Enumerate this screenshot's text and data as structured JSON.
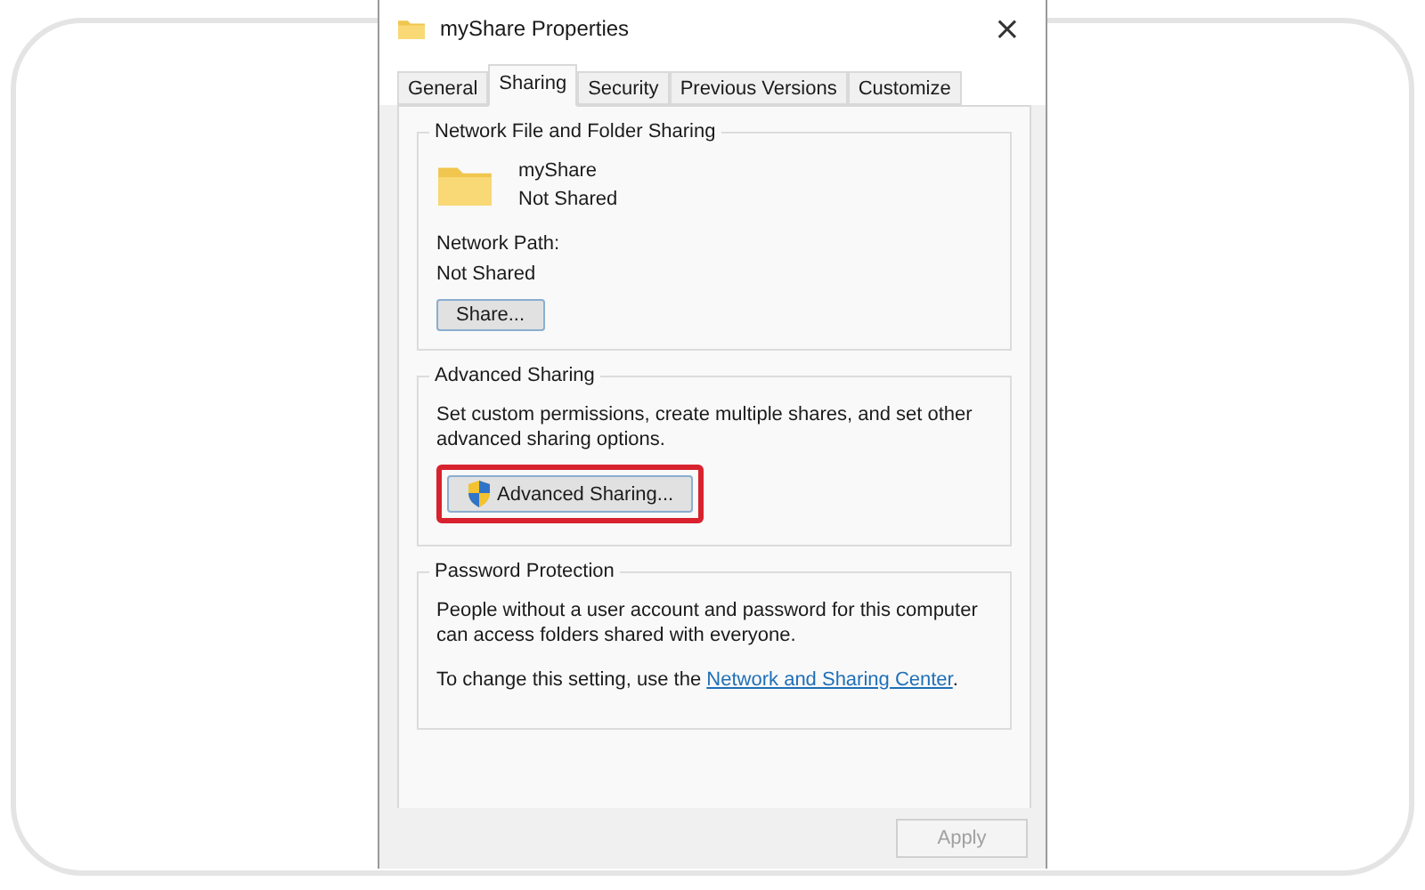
{
  "window": {
    "title": "myShare Properties",
    "close": "×"
  },
  "tabs": [
    {
      "label": "General",
      "selected": false
    },
    {
      "label": "Sharing",
      "selected": true
    },
    {
      "label": "Security",
      "selected": false
    },
    {
      "label": "Previous Versions",
      "selected": false
    },
    {
      "label": "Customize",
      "selected": false
    }
  ],
  "network_sharing": {
    "title": "Network File and Folder Sharing",
    "folder_name": "myShare",
    "folder_status": "Not Shared",
    "path_label": "Network Path:",
    "path_value": "Not Shared",
    "button": "Share..."
  },
  "advanced_sharing": {
    "title": "Advanced Sharing",
    "description": "Set custom permissions, create multiple shares, and set other advanced sharing options.",
    "button": "Advanced Sharing...",
    "highlighted": true
  },
  "password_protection": {
    "title": "Password Protection",
    "description": "People without a user account and password for this computer can access folders shared with everyone.",
    "hint": "To change this setting, use the",
    "link": "Network and Sharing Center",
    "hint_end": "."
  },
  "footer": {
    "buttons": [
      {
        "label": "Apply",
        "disabled": true
      }
    ]
  }
}
